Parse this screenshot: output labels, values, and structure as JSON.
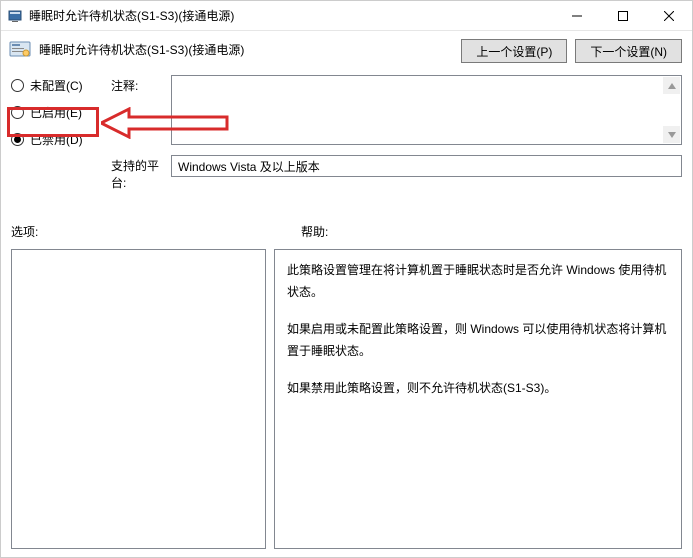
{
  "titlebar": {
    "title": "睡眠时允许待机状态(S1-S3)(接通电源)"
  },
  "header": {
    "title": "睡眠时允许待机状态(S1-S3)(接通电源)",
    "prev_btn": "上一个设置(P)",
    "next_btn": "下一个设置(N)"
  },
  "radios": {
    "not_configured": "未配置(C)",
    "enabled": "已启用(E)",
    "disabled": "已禁用(D)"
  },
  "labels": {
    "comment": "注释:",
    "supported_on": "支持的平台:",
    "options": "选项:",
    "help": "帮助:"
  },
  "values": {
    "supported_on": "Windows Vista 及以上版本"
  },
  "help": {
    "p1": "此策略设置管理在将计算机置于睡眠状态时是否允许 Windows 使用待机状态。",
    "p2": "如果启用或未配置此策略设置，则 Windows 可以使用待机状态将计算机置于睡眠状态。",
    "p3": "如果禁用此策略设置，则不允许待机状态(S1-S3)。"
  }
}
